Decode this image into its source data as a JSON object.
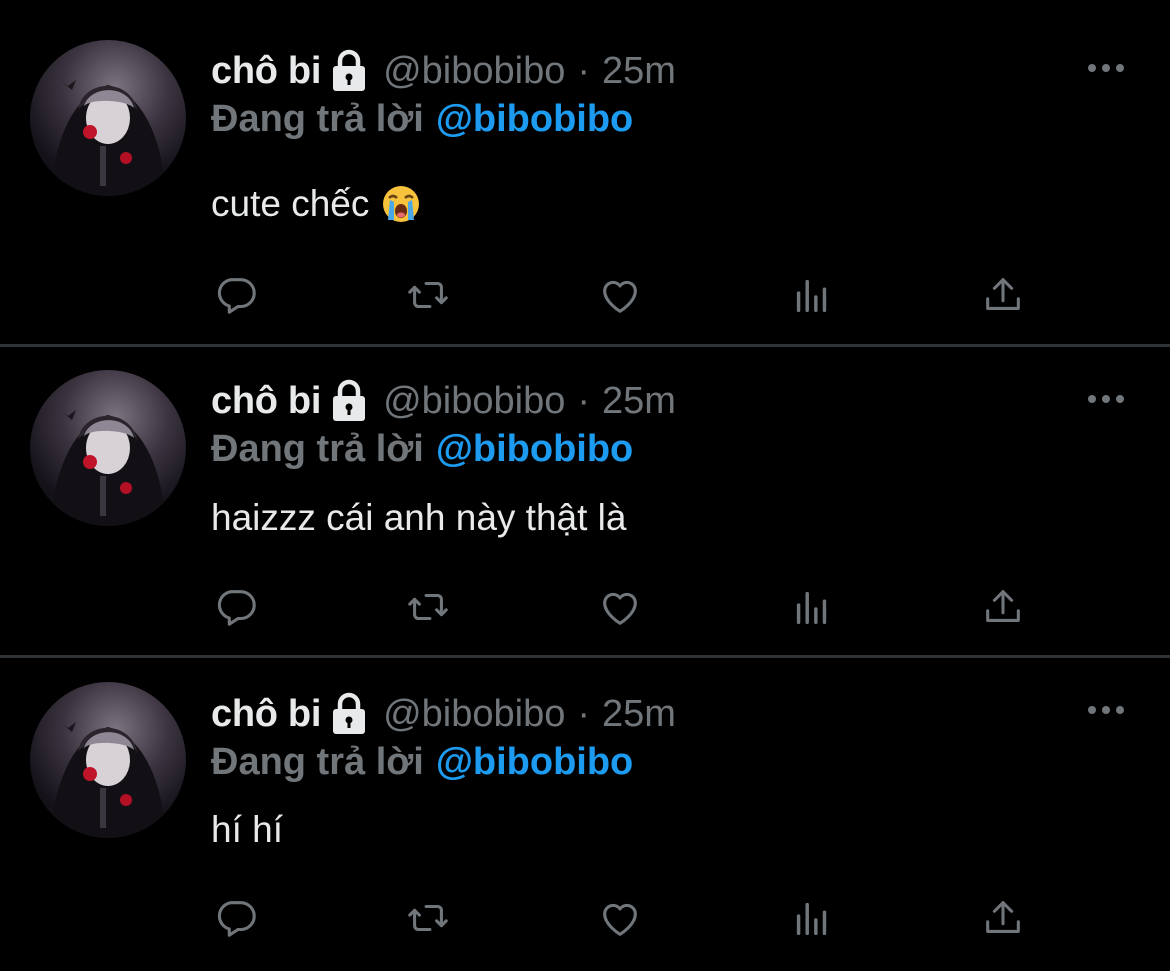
{
  "colors": {
    "background": "#000000",
    "divider": "#2f3336",
    "primary_text": "#e7e9ea",
    "secondary_text": "#71767b",
    "mention": "#1d9bf0"
  },
  "tweets": [
    {
      "author": {
        "display_name": "chô bi",
        "handle": "@bibobibo",
        "locked_icon": "lock-icon",
        "avatar": "avatar"
      },
      "separator": "·",
      "time": "25m",
      "reply": {
        "prefix": "Đang trả lời",
        "mention": "@bibobibo"
      },
      "text": "cute chếc",
      "emoji": "loudly-crying-face",
      "actions": [
        "reply-icon",
        "retweet-icon",
        "like-icon",
        "views-icon",
        "share-icon"
      ],
      "more_icon": "more-icon"
    },
    {
      "author": {
        "display_name": "chô bi",
        "handle": "@bibobibo",
        "locked_icon": "lock-icon",
        "avatar": "avatar"
      },
      "separator": "·",
      "time": "25m",
      "reply": {
        "prefix": "Đang trả lời",
        "mention": "@bibobibo"
      },
      "text": "haizzz cái anh này thật là",
      "actions": [
        "reply-icon",
        "retweet-icon",
        "like-icon",
        "views-icon",
        "share-icon"
      ],
      "more_icon": "more-icon"
    },
    {
      "author": {
        "display_name": "chô bi",
        "handle": "@bibobibo",
        "locked_icon": "lock-icon",
        "avatar": "avatar"
      },
      "separator": "·",
      "time": "25m",
      "reply": {
        "prefix": "Đang trả lời",
        "mention": "@bibobibo"
      },
      "text": "hí hí",
      "actions": [
        "reply-icon",
        "retweet-icon",
        "like-icon",
        "views-icon",
        "share-icon"
      ],
      "more_icon": "more-icon"
    }
  ]
}
